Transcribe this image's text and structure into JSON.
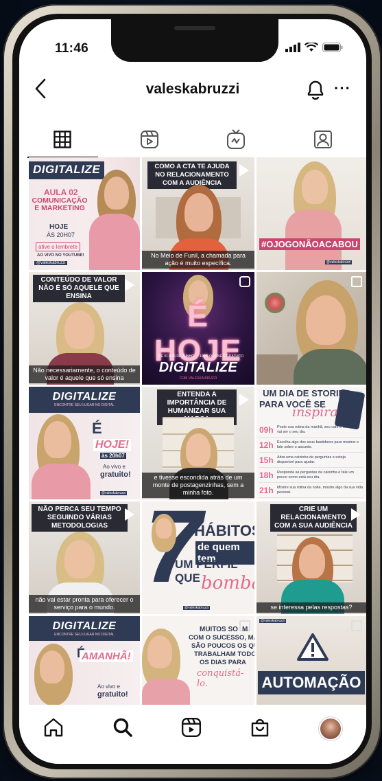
{
  "status_bar": {
    "time": "11:46"
  },
  "header": {
    "username": "valeskabruzzi",
    "more": "···"
  },
  "tabs": [
    "grid-icon",
    "reels-icon",
    "igtv-icon",
    "tagged-icon"
  ],
  "posts": {
    "p1": {
      "title": "DIGITALIZE",
      "class": "AULA 02",
      "subject": "COMUNICAÇÃO E MARKETING",
      "date": "HOJE",
      "time": "ÀS 20H07",
      "cta": "ative o lembrete",
      "live": "AO VIVO NO YOUTUBE!",
      "handle": "@valeskabruzzi"
    },
    "p2": {
      "banner": "COMO A CTA TE AJUDA NO RELACIONAMENTO COM A AUDIÊNCIA",
      "sub": "No Meio de Funil, a chamada para ação é muito específica."
    },
    "p3": {
      "tag": "#OJOGONÃOACABOU",
      "handle": "@valeskabruzzi"
    },
    "p4": {
      "banner": "CONTEÚDO DE VALOR NÃO É SÓ AQUELE QUE ENSINA",
      "sub": "Não necessariamente, o conteúdo de valor é aquele que só ensina"
    },
    "p5": {
      "big": "É HOJE",
      "dates": "DE 01 A 06 DE JUNHO",
      "online": "100% ONLINE E GRATUITO",
      "title": "DIGITALIZE",
      "by": "COM VALESKA BRUZZI"
    },
    "p6": {},
    "p7": {
      "title": "DIGITALIZE",
      "sub": "ENCONTRE SEU LUGAR NO DIGITAL",
      "e": "É",
      "hoje": "HOJE!",
      "time": "às 20h07",
      "live": "Ao vivo e",
      "free": "gratuito!",
      "handle": "@valeskabruzzi"
    },
    "p8": {
      "banner": "ENTENDA A IMPORTÂNCIA DE HUMANIZAR SUA MARCA",
      "sub": "e tivesse escondida atrás de um monte de postagenzinhas, sem a minha foto."
    },
    "p9": {
      "title1": "UM DIA DE STORIES",
      "title2": "PARA VOCÊ SE",
      "script": "inspirar",
      "rows": [
        {
          "t": "09h",
          "d": "Poste sua rotina da manhã, seu café e fale como vai ser o seu dia."
        },
        {
          "t": "12h",
          "d": "Escolha algo dos seus bastidores para mostrar e fale sobre o assunto."
        },
        {
          "t": "15h",
          "d": "Abra uma caixinha de perguntas e esteja disponível para ajudar."
        },
        {
          "t": "18h",
          "d": "Responda as perguntas da caixinha e fale um pouco como está seu dia."
        },
        {
          "t": "21h",
          "d": "Mostre sua rotina da noite, mostre algo da sua vida pessoal."
        }
      ]
    },
    "p10": {
      "banner": "NÃO PERCA SEU TEMPO SEGUINDO VÁRIAS METODOLOGIAS",
      "sub": "não vai estar pronta para oferecer o serviço para o mundo."
    },
    "p11": {
      "num": "7",
      "l1": "HÁBITOS",
      "l2": "de quem tem",
      "l3": "UM PERFIL QUE",
      "l4": "bomba",
      "handle": "@valeskabruzzi"
    },
    "p12": {
      "banner": "CRIE UM RELACIONAMENTO COM A SUA AUDIÊNCIA",
      "sub": "se interessa pelas respostas?"
    },
    "p13": {
      "title": "DIGITALIZE",
      "sub": "ENCONTRE SEU LUGAR NO DIGITAL",
      "e": "É",
      "amanha": "AMANHÃ!",
      "live": "Ao vivo e",
      "free": "gratuito!"
    },
    "p14": {
      "l1": "MUITOS SO",
      "l1b": "M",
      "l2": "COM O SUCESSO, MAS",
      "l3": "SÃO POUCOS OS QUE",
      "l4": "TRABALHAM TODOS",
      "l5": "OS DIAS PARA",
      "l6": "conquistá-lo."
    },
    "p15": {
      "handle": "@valeskabruzzi",
      "word": "AUTOMAÇÃO"
    }
  },
  "colors": {
    "pink": "#e36b8d",
    "navy": "#2f3a55",
    "dark_purple": "#1f1433"
  }
}
